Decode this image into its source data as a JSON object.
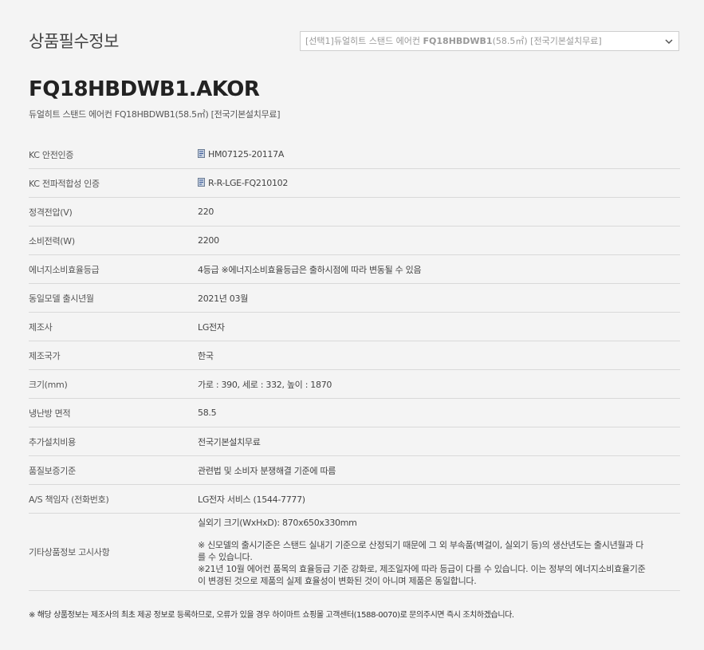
{
  "header": {
    "title": "상품필수정보",
    "option_select": {
      "prefix": "[선택1]듀얼히트 스탠드 에어컨 ",
      "model": "FQ18HBDWB1",
      "suffix": "(58.5㎡) [전국기본설치무료]"
    }
  },
  "product": {
    "model_code": "FQ18HBDWB1.AKOR",
    "name": "듀얼히트 스탠드 에어컨 FQ18HBDWB1(58.5㎡) [전국기본설치무료]"
  },
  "rows": [
    {
      "label": "KC 안전인증",
      "value": "HM07125-20117A",
      "icon": "certificate-icon"
    },
    {
      "label": "KC 전파적합성 인증",
      "value": "R-R-LGE-FQ210102",
      "icon": "certificate-icon"
    },
    {
      "label": "정격전압(V)",
      "value": "220"
    },
    {
      "label": "소비전력(W)",
      "value": "2200"
    },
    {
      "label": "에너지소비효율등급",
      "value": "4등급  ※에너지소비효율등급은 출하시점에 따라 변동될 수 있음"
    },
    {
      "label": "동일모델 출시년월",
      "value": "2021년 03월"
    },
    {
      "label": "제조사",
      "value": "LG전자"
    },
    {
      "label": "제조국가",
      "value": "한국"
    },
    {
      "label": "크기(mm)",
      "value": "가로 : 390, 세로 : 332, 높이 : 1870"
    },
    {
      "label": "냉난방 면적",
      "value": "58.5"
    },
    {
      "label": "추가설치비용",
      "value": "전국기본설치무료"
    },
    {
      "label": "품질보증기준",
      "value": "관련법 및 소비자 분쟁해결 기준에 따름"
    },
    {
      "label": "A/S 책임자 (전화번호)",
      "value": "LG전자 서비스 (1544-7777)"
    }
  ],
  "other_info": {
    "label": "기타상품정보 고시사항",
    "line1": "실외기 크기(WxHxD): 870x650x330mm",
    "line2": "※ 신모델의 출시기준은 스탠드 실내기 기준으로 산정되기 때문에 그 외 부속품(벽걸이, 실외기 등)의 생산년도는 출시년월과 다",
    "line3": "를 수 있습니다.",
    "line4": "※21년 10월 에어컨 품목의 효율등급 기준 강화로, 제조일자에 따라 등급이 다를 수 있습니다. 이는 정부의 에너지소비효율기준",
    "line5": "이 변경된 것으로 제품의 실제 효율성이 변화된 것이 아니며 제품은 동일합니다."
  },
  "footer": {
    "note": "※ 해당 상품정보는 제조사의 최초 제공 정보로 등록하므로, 오류가 있을 경우 하이마트 쇼핑몰 고객센터(1588-0070)로 문의주시면 즉시 조치하겠습니다."
  }
}
